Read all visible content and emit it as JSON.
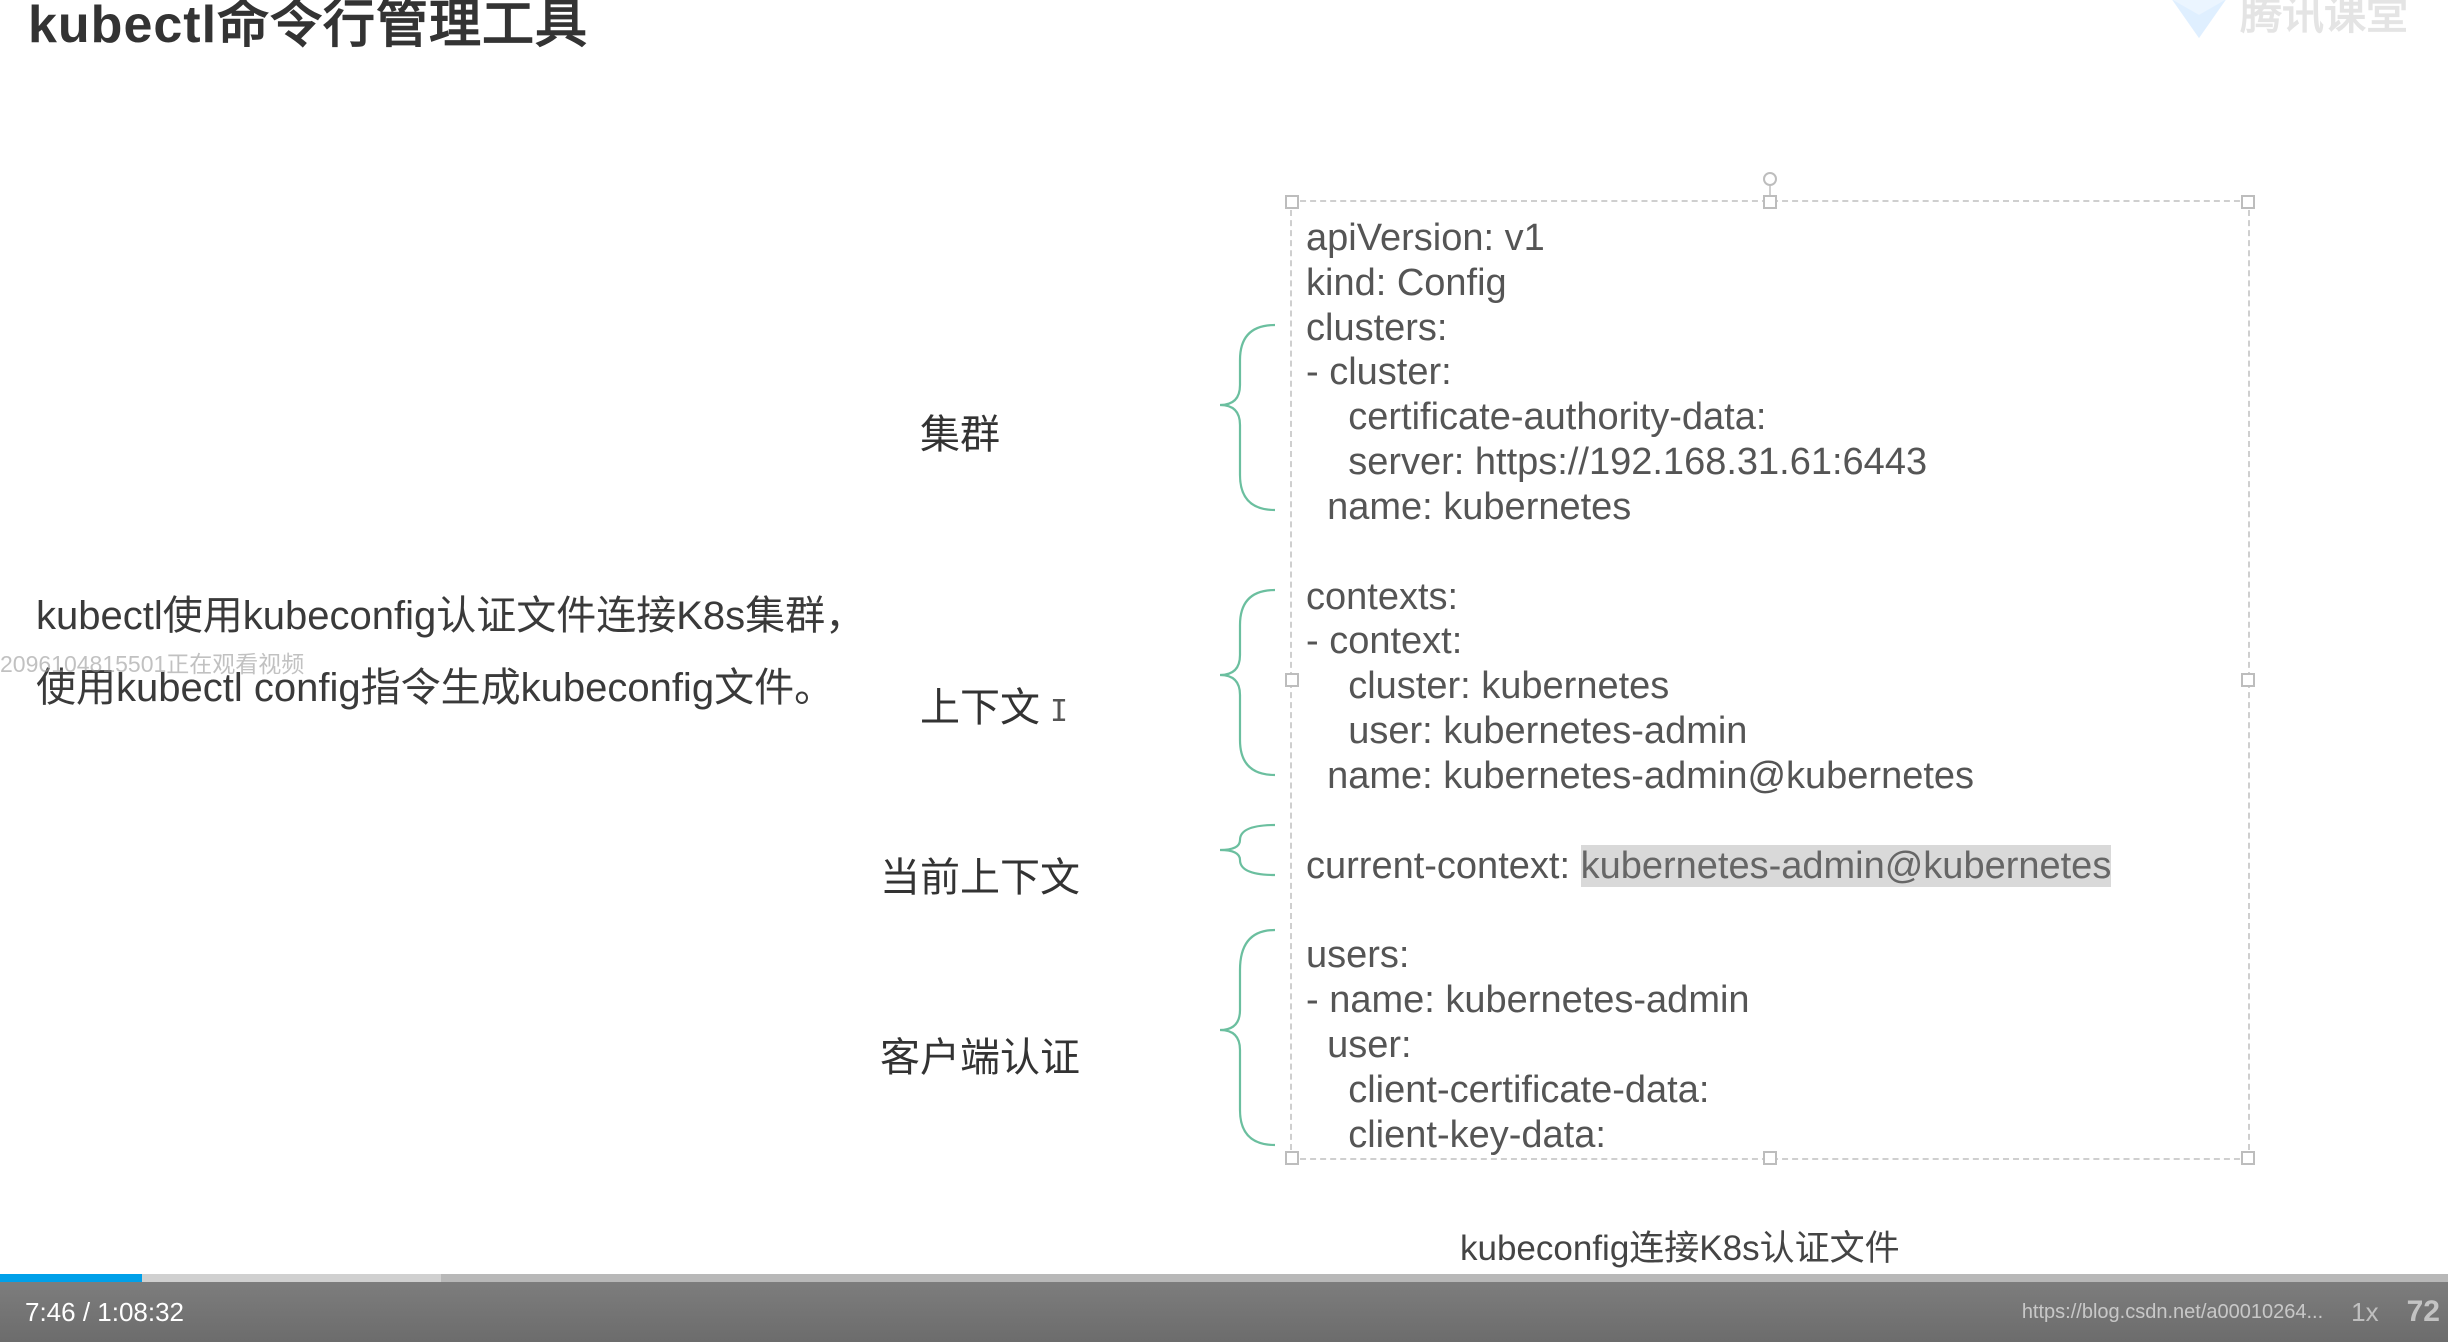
{
  "title": "kubectl命令行管理工具",
  "watermark_text": "腾讯课堂",
  "left_text": {
    "line1": "kubectl使用kubeconfig认证文件连接K8s集群，",
    "line2": "使用kubectl config指令生成kubeconfig文件。"
  },
  "viewer_overlay": "2096104815501正在观看视频",
  "section_labels": {
    "cluster": "集群",
    "context": "上下文",
    "current_context": "当前上下文",
    "client_auth": "客户端认证"
  },
  "config": {
    "l1": "apiVersion: v1",
    "l2": "kind: Config",
    "l3": "clusters:",
    "l4": "- cluster:",
    "l5": "    certificate-authority-data:",
    "l6": "    server: https://192.168.31.61:6443",
    "l7": "  name: kubernetes",
    "l8": "contexts:",
    "l9": "- context:",
    "l10": "    cluster: kubernetes",
    "l11": "    user: kubernetes-admin",
    "l12": "  name: kubernetes-admin@kubernetes",
    "l13a": "current-context: ",
    "l13b": "kubernetes-admin@kubernetes",
    "l14": "users:",
    "l15": "- name: kubernetes-admin",
    "l16": "  user:",
    "l17": "    client-certificate-data:",
    "l18": "    client-key-data:"
  },
  "caption": "kubeconfig连接K8s认证文件",
  "player": {
    "time": "7:46 / 1:08:32",
    "url_hint": "https://blog.csdn.net/a00010264...",
    "speed": "1x",
    "right_num": "72"
  }
}
